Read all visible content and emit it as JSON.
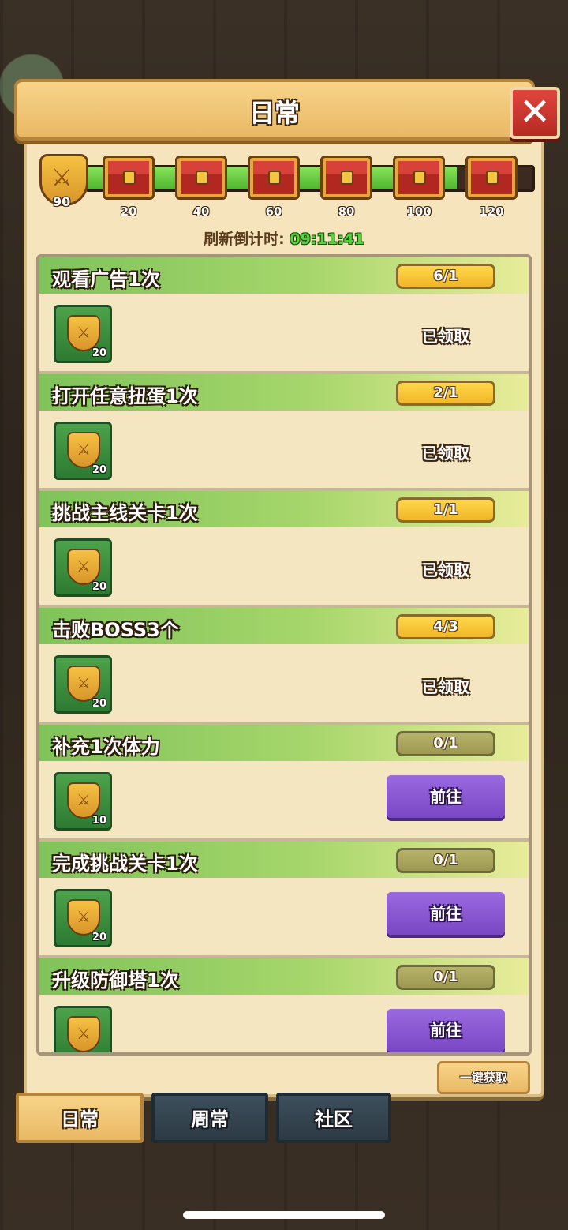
{
  "header": {
    "title": "日常",
    "close_symbol": "✕"
  },
  "points": {
    "current": "90"
  },
  "milestones": [
    {
      "label": "20"
    },
    {
      "label": "40"
    },
    {
      "label": "60"
    },
    {
      "label": "80"
    },
    {
      "label": "100"
    },
    {
      "label": "120"
    }
  ],
  "progress_fraction": 0.83,
  "refresh": {
    "label": "刷新倒计时:",
    "time": "09:11:41"
  },
  "tasks": [
    {
      "title": "观看广告1次",
      "count": "6/1",
      "reward": "20",
      "status": "已领取"
    },
    {
      "title": "打开任意扭蛋1次",
      "count": "2/1",
      "reward": "20",
      "status": "已领取"
    },
    {
      "title": "挑战主线关卡1次",
      "count": "1/1",
      "reward": "20",
      "status": "已领取"
    },
    {
      "title": "击败BOSS3个",
      "count": "4/3",
      "reward": "20",
      "status": "已领取"
    },
    {
      "title": "补充1次体力",
      "count": "0/1",
      "reward": "10",
      "action": "前往"
    },
    {
      "title": "完成挑战关卡1次",
      "count": "0/1",
      "reward": "20",
      "action": "前往"
    },
    {
      "title": "升级防御塔1次",
      "count": "0/1",
      "reward": "",
      "action": "前往"
    }
  ],
  "claim_all_label": "一键获取",
  "tabs": [
    {
      "label": "日常",
      "active": true
    },
    {
      "label": "周常",
      "active": false
    },
    {
      "label": "社区",
      "active": false
    }
  ],
  "colors": {
    "accent_gold": "#f0b628",
    "go_purple": "#7a47c4",
    "progress_green": "#4fb52e",
    "close_red": "#b52a24"
  }
}
